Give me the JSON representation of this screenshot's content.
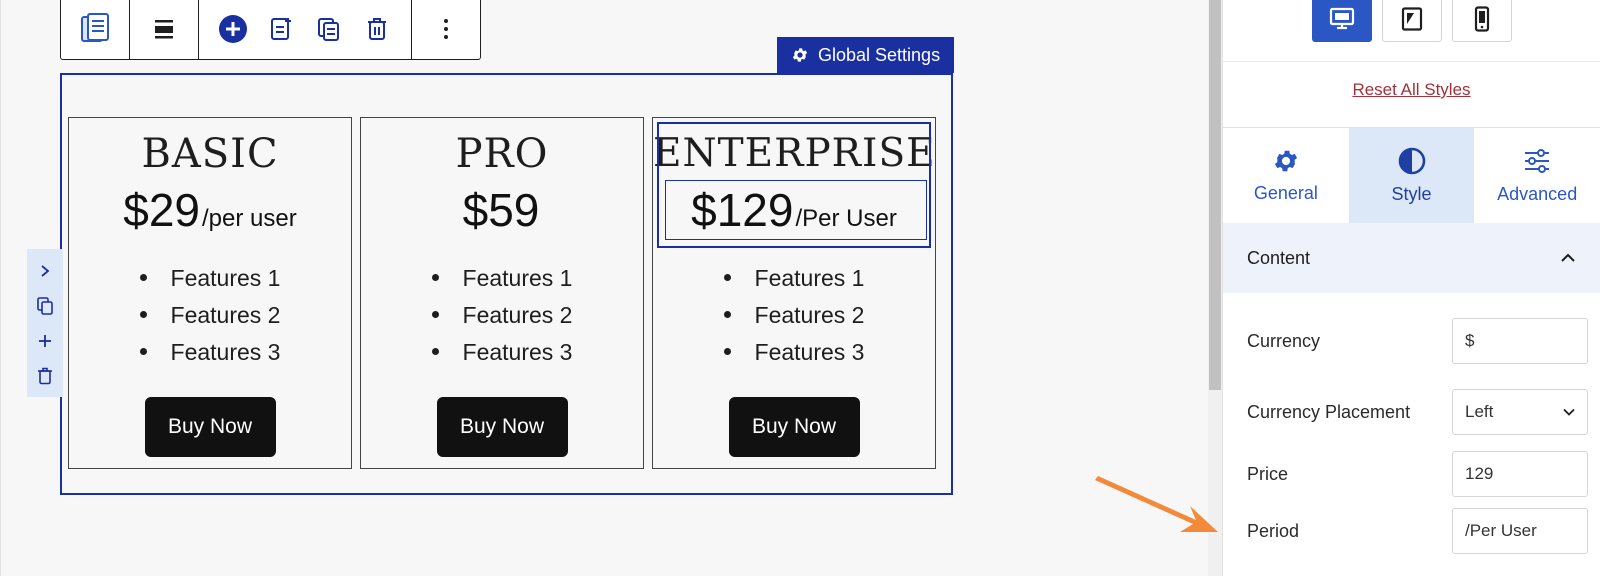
{
  "toolbar": {
    "icons": [
      "pricing-table-block-icon",
      "align-icon",
      "add-icon",
      "add-item-icon",
      "duplicate-icon",
      "delete-icon",
      "more-options-icon"
    ]
  },
  "global_settings": {
    "label": "Global Settings"
  },
  "cards": [
    {
      "title": "BASIC",
      "amount": "$29",
      "period": "/per user",
      "features": [
        "Features 1",
        "Features 2",
        "Features 3"
      ],
      "button": "Buy Now"
    },
    {
      "title": "PRO",
      "amount": "$59",
      "period": "",
      "features": [
        "Features 1",
        "Features 2",
        "Features 3"
      ],
      "button": "Buy Now"
    },
    {
      "title": "ENTERPRISE",
      "amount": "$129",
      "period": "/Per User",
      "features": [
        "Features 1",
        "Features 2",
        "Features 3"
      ],
      "button": "Buy Now"
    }
  ],
  "panel": {
    "reset_label": "Reset All Styles",
    "tabs": [
      {
        "label": "General",
        "icon": "gear-icon"
      },
      {
        "label": "Style",
        "icon": "contrast-icon"
      },
      {
        "label": "Advanced",
        "icon": "sliders-icon"
      }
    ],
    "section": "Content",
    "fields": {
      "currency": {
        "label": "Currency",
        "value": "$"
      },
      "placement": {
        "label": "Currency Placement",
        "value": "Left"
      },
      "price": {
        "label": "Price",
        "value": "129"
      },
      "period": {
        "label": "Period",
        "value": "/Per User"
      }
    }
  },
  "colors": {
    "accent": "#1a2fa0",
    "panel_accent": "#2b57c5",
    "arrow": "#f28a3a",
    "reset_link": "#a0323c"
  }
}
